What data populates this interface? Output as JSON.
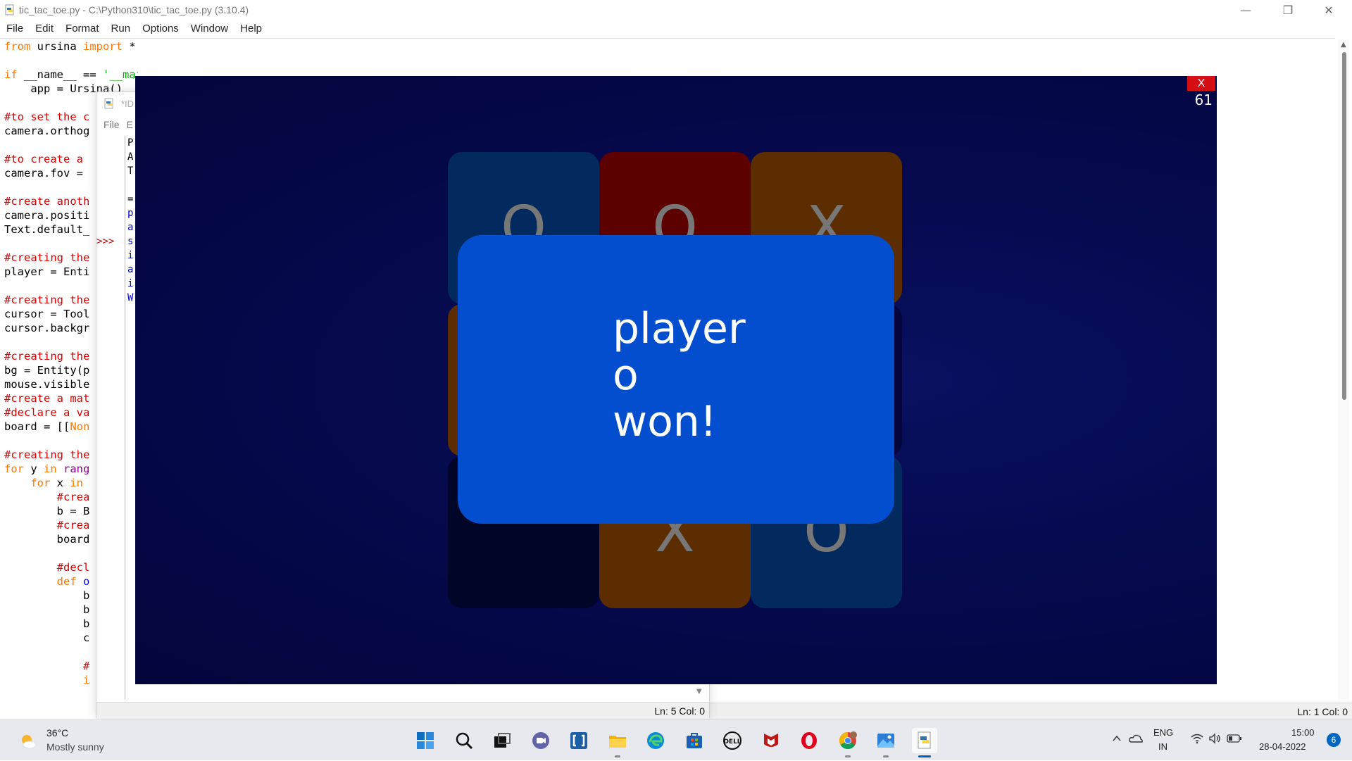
{
  "editor": {
    "title": "tic_tac_toe.py - C:\\Python310\\tic_tac_toe.py (3.10.4)",
    "menu": [
      "File",
      "Edit",
      "Format",
      "Run",
      "Options",
      "Window",
      "Help"
    ],
    "window_controls": {
      "minimize": "—",
      "restore": "❐",
      "close": "✕"
    },
    "code_lines": [
      [
        {
          "t": "from",
          "c": "#ff7700"
        },
        {
          "t": " ursina ",
          "c": "#000"
        },
        {
          "t": "import",
          "c": "#ff7700"
        },
        {
          "t": " *",
          "c": "#000"
        }
      ],
      [],
      [
        {
          "t": "if",
          "c": "#ff7700"
        },
        {
          "t": " __name__ == ",
          "c": "#000"
        },
        {
          "t": "'__main__'",
          "c": "#00aa00"
        },
        {
          "t": ":",
          "c": "#000"
        }
      ],
      [
        {
          "t": "    app = Ursina()",
          "c": "#000"
        }
      ],
      [],
      [
        {
          "t": "#to set the c",
          "c": "#dd0000"
        }
      ],
      [
        {
          "t": "camera.orthog",
          "c": "#000"
        }
      ],
      [],
      [
        {
          "t": "#to create a",
          "c": "#dd0000"
        }
      ],
      [
        {
          "t": "camera.fov = ",
          "c": "#000"
        }
      ],
      [],
      [
        {
          "t": "#create anoth",
          "c": "#dd0000"
        }
      ],
      [
        {
          "t": "camera.positi",
          "c": "#000"
        }
      ],
      [
        {
          "t": "Text.default_",
          "c": "#000"
        }
      ],
      [],
      [
        {
          "t": "#creating the",
          "c": "#dd0000"
        }
      ],
      [
        {
          "t": "player = Enti",
          "c": "#000"
        }
      ],
      [],
      [
        {
          "t": "#creating the",
          "c": "#dd0000"
        }
      ],
      [
        {
          "t": "cursor = Tool",
          "c": "#000"
        }
      ],
      [
        {
          "t": "cursor.backgr",
          "c": "#000"
        }
      ],
      [],
      [
        {
          "t": "#creating the",
          "c": "#dd0000"
        }
      ],
      [
        {
          "t": "bg = Entity(p",
          "c": "#000"
        }
      ],
      [
        {
          "t": "mouse.visible",
          "c": "#000"
        }
      ],
      [
        {
          "t": "#create a mat",
          "c": "#dd0000"
        }
      ],
      [
        {
          "t": "#declare a va",
          "c": "#dd0000"
        }
      ],
      [
        {
          "t": "board = [[",
          "c": "#000"
        },
        {
          "t": "Non",
          "c": "#ff7700"
        }
      ],
      [],
      [
        {
          "t": "#creating the",
          "c": "#dd0000"
        }
      ],
      [
        {
          "t": "for",
          "c": "#ff7700"
        },
        {
          "t": " y ",
          "c": "#000"
        },
        {
          "t": "in",
          "c": "#ff7700"
        },
        {
          "t": " ",
          "c": "#000"
        },
        {
          "t": "rang",
          "c": "#900090"
        }
      ],
      [
        {
          "t": "    ",
          "c": "#000"
        },
        {
          "t": "for",
          "c": "#ff7700"
        },
        {
          "t": " x ",
          "c": "#000"
        },
        {
          "t": "in",
          "c": "#ff7700"
        }
      ],
      [
        {
          "t": "        #crea",
          "c": "#dd0000"
        }
      ],
      [
        {
          "t": "        b = B",
          "c": "#000"
        }
      ],
      [
        {
          "t": "        #crea",
          "c": "#dd0000"
        }
      ],
      [
        {
          "t": "        board",
          "c": "#000"
        }
      ],
      [],
      [
        {
          "t": "        #decl",
          "c": "#dd0000"
        }
      ],
      [
        {
          "t": "        ",
          "c": "#000"
        },
        {
          "t": "def",
          "c": "#ff7700"
        },
        {
          "t": " o",
          "c": "#0000ff"
        }
      ],
      [
        {
          "t": "            b",
          "c": "#000"
        }
      ],
      [
        {
          "t": "            b",
          "c": "#000"
        }
      ],
      [
        {
          "t": "            b",
          "c": "#000"
        }
      ],
      [
        {
          "t": "            c",
          "c": "#000"
        }
      ],
      [],
      [
        {
          "t": "            #",
          "c": "#dd0000"
        }
      ],
      [
        {
          "t": "            i",
          "c": "#ff7700"
        }
      ]
    ],
    "status": "Ln: 1   Col: 0"
  },
  "shell": {
    "title": "*ID",
    "menu": [
      "File",
      "E"
    ],
    "prompt": ">>>",
    "text_lines": [
      {
        "t": "P",
        "c": "#000"
      },
      {
        "t": "A",
        "c": "#000"
      },
      {
        "t": "T",
        "c": "#000"
      },
      {
        "t": "",
        "c": "#000"
      },
      {
        "t": "=",
        "c": "#000"
      },
      {
        "t": "p",
        "c": "#0000cc"
      },
      {
        "t": "a",
        "c": "#0000cc"
      },
      {
        "t": "s",
        "c": "#0000cc"
      },
      {
        "t": "i",
        "c": "#0000cc"
      },
      {
        "t": "a",
        "c": "#0000cc"
      },
      {
        "t": "i",
        "c": "#0000cc"
      },
      {
        "t": "W",
        "c": "#0000cc"
      }
    ],
    "status": "Ln: 5   Col: 0"
  },
  "game": {
    "close_label": "X",
    "fps": "61",
    "board": [
      [
        {
          "mark": "O",
          "color": "#022a5e"
        },
        {
          "mark": "O",
          "color": "#5c0000"
        },
        {
          "mark": "X",
          "color": "#5c2d00"
        }
      ],
      [
        {
          "mark": "",
          "color": "#5c2d00"
        },
        {
          "mark": "",
          "color": "#03053c"
        },
        {
          "mark": "",
          "color": "#03053c"
        }
      ],
      [
        {
          "mark": "",
          "color": "#010527"
        },
        {
          "mark": "X",
          "color": "#5c2d00"
        },
        {
          "mark": "O",
          "color": "#022a5e"
        }
      ]
    ],
    "win_lines": [
      "player",
      "o",
      "won!"
    ],
    "colors": {
      "panel": "#034ecf",
      "close": "#d60f17",
      "background": "#03053c"
    }
  },
  "taskbar": {
    "weather": {
      "temp": "36°C",
      "condition": "Mostly sunny"
    },
    "apps": [
      {
        "name": "start-icon",
        "running": false
      },
      {
        "name": "search-icon",
        "running": false
      },
      {
        "name": "task-view-icon",
        "running": false
      },
      {
        "name": "teams-chat-icon",
        "running": false
      },
      {
        "name": "bracket-app-icon",
        "running": false
      },
      {
        "name": "file-explorer-icon",
        "running": true
      },
      {
        "name": "edge-browser-icon",
        "running": false
      },
      {
        "name": "microsoft-store-icon",
        "running": false
      },
      {
        "name": "dell-icon",
        "running": false
      },
      {
        "name": "mcafee-icon",
        "running": false
      },
      {
        "name": "opera-browser-icon",
        "running": false
      },
      {
        "name": "chrome-browser-icon",
        "running": true
      },
      {
        "name": "photos-icon",
        "running": true
      },
      {
        "name": "python-idle-icon",
        "running": true,
        "active": true
      }
    ],
    "language": {
      "line1": "ENG",
      "line2": "IN"
    },
    "clock": {
      "time": "15:00",
      "date": "28-04-2022"
    },
    "notifications": "6"
  }
}
